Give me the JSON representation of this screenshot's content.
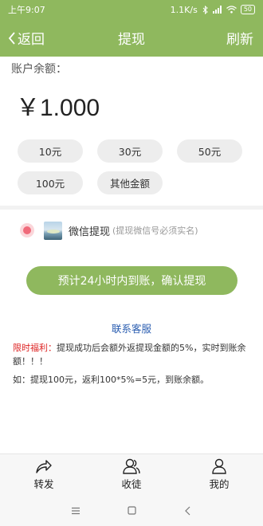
{
  "statusbar": {
    "time": "上午9:07",
    "network_speed": "1.1K/s",
    "battery": "50"
  },
  "header": {
    "back_label": "返回",
    "title": "提现",
    "refresh_label": "刷新"
  },
  "balance": {
    "label": "账户余额：",
    "amount": "￥1.000"
  },
  "amount_options": [
    "10元",
    "30元",
    "50元",
    "100元",
    "其他金额"
  ],
  "payment": {
    "method_label": "微信提现",
    "method_note": "(提现微信号必须实名)"
  },
  "confirm_button": "预计24小时内到账，确认提现",
  "service_link": "联系客服",
  "notice": {
    "highlight": "限时福利：",
    "text": "提现成功后会额外返提现金额的5%，实时到账余额！！！",
    "example": "如：提现100元，返利100*5%=5元，到账余额。"
  },
  "tabs": [
    {
      "label": "转发",
      "icon": "share-icon"
    },
    {
      "label": "收徒",
      "icon": "users-icon"
    },
    {
      "label": "我的",
      "icon": "user-icon"
    }
  ],
  "colors": {
    "brand_green": "#8fb85e",
    "radio_red": "#f06a7a",
    "link_blue": "#2a5db0",
    "highlight_red": "#dd2222"
  }
}
